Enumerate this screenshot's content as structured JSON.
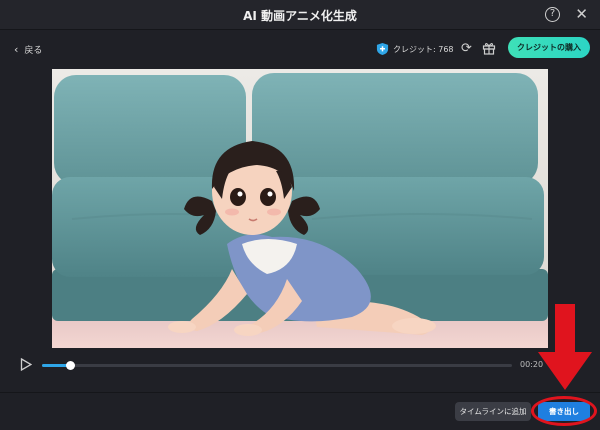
{
  "window": {
    "title": "AI 動画アニメ化生成"
  },
  "toolbar": {
    "back_label": "戻る",
    "credit_label": "クレジット: 768",
    "buy_label": "クレジットの購入"
  },
  "player": {
    "time": "00:20",
    "progress": 0.06
  },
  "actions": {
    "timeline_label": "タイムラインに追加",
    "export_label": "書き出し"
  },
  "colors": {
    "accent_teal": "#3ee0b8",
    "export_blue": "#1f7fe0",
    "annotation_red": "#e0141e"
  },
  "icons": [
    "help-icon",
    "close-icon",
    "back-chevron-icon",
    "credit-shield-icon",
    "refresh-icon",
    "gift-icon",
    "play-icon",
    "down-arrow-annotation-icon"
  ]
}
